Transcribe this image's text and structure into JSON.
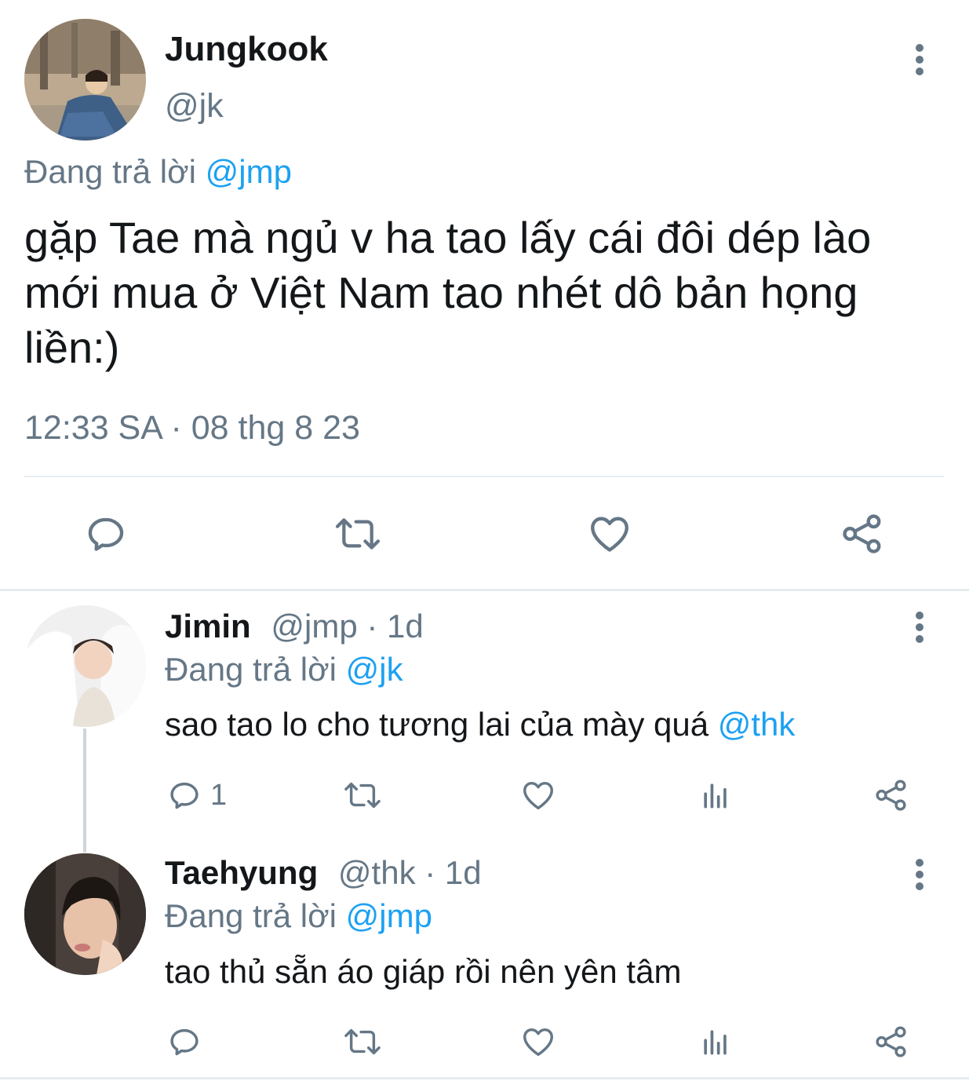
{
  "main_tweet": {
    "author_name": "Jungkook",
    "handle": "@jk",
    "replying_prefix": "Đang trả lời",
    "replying_to": "@jmp",
    "text": "gặp Tae mà ngủ v ha tao lấy cái đôi dép lào mới mua ở Việt Nam tao nhét dô bản họng liền:)",
    "timestamp": "12:33 SA · 08 thg 8 23",
    "actions": [
      "reply-icon",
      "retweet-icon",
      "like-icon",
      "share-icon"
    ]
  },
  "replies": [
    {
      "author_name": "Jimin",
      "handle": "@jmp",
      "time": "· 1d",
      "replying_prefix": "Đang trả lời",
      "replying_to": "@jk",
      "text": "sao tao lo cho tương lai của mày quá",
      "mention": "@thk",
      "reply_count": "1"
    },
    {
      "author_name": "Taehyung",
      "handle": "@thk",
      "time": "· 1d",
      "replying_prefix": "Đang trả lời",
      "replying_to": "@jmp",
      "text": "tao thủ sẵn áo giáp rồi nên yên tâm",
      "reply_count": ""
    }
  ],
  "colors": {
    "accent": "#1da1f2",
    "muted": "#657786",
    "text": "#14171a",
    "divider": "#e6ecf0"
  }
}
